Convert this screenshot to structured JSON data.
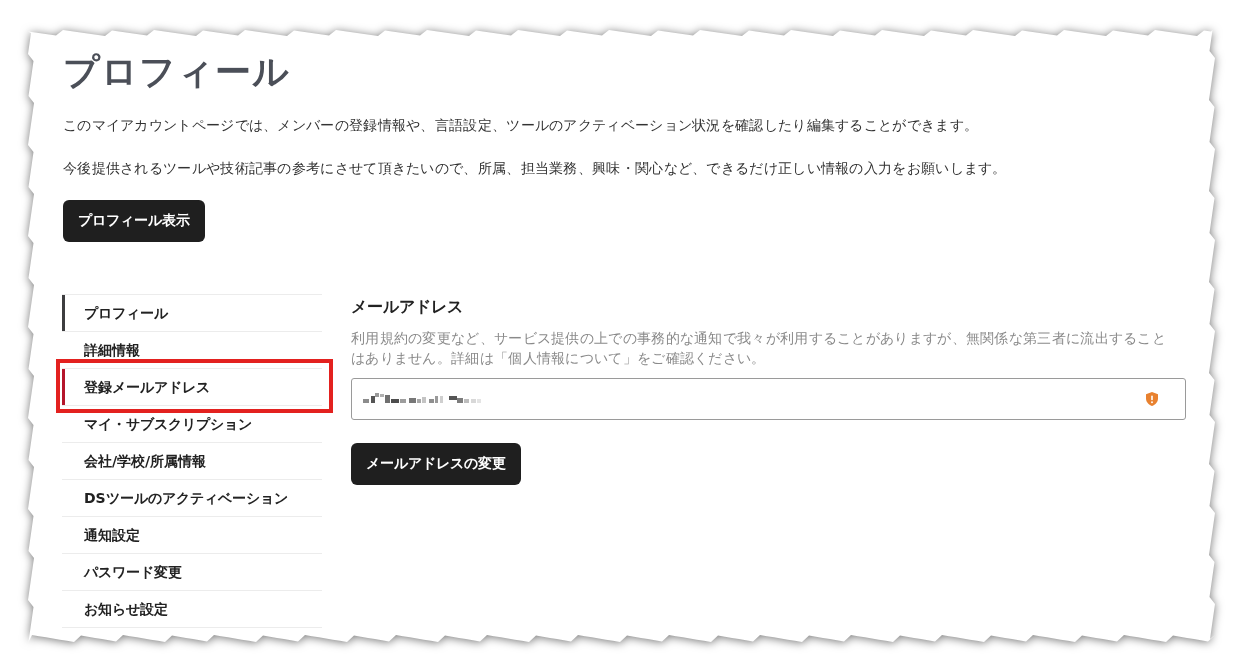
{
  "page": {
    "title": "プロフィール",
    "intro": [
      "このマイアカウントページでは、メンバーの登録情報や、言語設定、ツールのアクティベーション状況を確認したり編集することができます。",
      "今後提供されるツールや技術記事の参考にさせて頂きたいので、所属、担当業務、興味・関心など、できるだけ正しい情報の入力をお願いします。"
    ],
    "view_button": "プロフィール表示"
  },
  "sidebar": {
    "items": [
      {
        "label": "プロフィール",
        "active": true,
        "selected": false,
        "highlighted": false
      },
      {
        "label": "詳細情報",
        "active": false,
        "selected": false,
        "highlighted": false
      },
      {
        "label": "登録メールアドレス",
        "active": false,
        "selected": true,
        "highlighted": true
      },
      {
        "label": "マイ・サブスクリプション",
        "active": false,
        "selected": false,
        "highlighted": false
      },
      {
        "label": "会社/学校/所属情報",
        "active": false,
        "selected": false,
        "highlighted": false
      },
      {
        "label": "DSツールのアクティベーション",
        "active": false,
        "selected": false,
        "highlighted": false
      },
      {
        "label": "通知設定",
        "active": false,
        "selected": false,
        "highlighted": false
      },
      {
        "label": "パスワード変更",
        "active": false,
        "selected": false,
        "highlighted": false
      },
      {
        "label": "お知らせ設定",
        "active": false,
        "selected": false,
        "highlighted": false
      }
    ]
  },
  "email_section": {
    "heading": "メールアドレス",
    "description": "利用規約の変更など、サービス提供の上での事務的な通知で我々が利用することがありますが、無関係な第三者に流出することはありません。詳細は「個人情報について」をご確認ください。",
    "field": {
      "redacted": true
    },
    "change_button": "メールアドレスの変更"
  }
}
